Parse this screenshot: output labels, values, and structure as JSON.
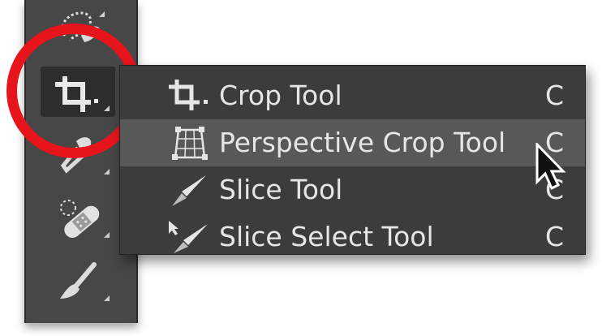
{
  "toolbar": {
    "tools": [
      {
        "name": "lasso-tool",
        "icon": "lasso-icon"
      },
      {
        "name": "crop-tool",
        "icon": "crop-icon",
        "active": true
      },
      {
        "name": "eyedropper-tool",
        "icon": "eyedropper-icon"
      },
      {
        "name": "healing-brush-tool",
        "icon": "bandage-icon"
      },
      {
        "name": "brush-tool",
        "icon": "brush-icon"
      }
    ]
  },
  "flyout": {
    "items": [
      {
        "label": "Crop Tool",
        "shortcut": "C",
        "icon": "crop-icon"
      },
      {
        "label": "Perspective Crop Tool",
        "shortcut": "C",
        "icon": "perspective-crop-icon",
        "hovered": true
      },
      {
        "label": "Slice Tool",
        "shortcut": "C",
        "icon": "slice-icon"
      },
      {
        "label": "Slice Select Tool",
        "shortcut": "C",
        "icon": "slice-select-icon"
      }
    ]
  },
  "colors": {
    "highlight_ring": "#e8141b",
    "toolbar_bg": "#474747",
    "flyout_bg": "#3c3c3c",
    "hover_bg": "#585858",
    "text": "#e6e6e6"
  }
}
